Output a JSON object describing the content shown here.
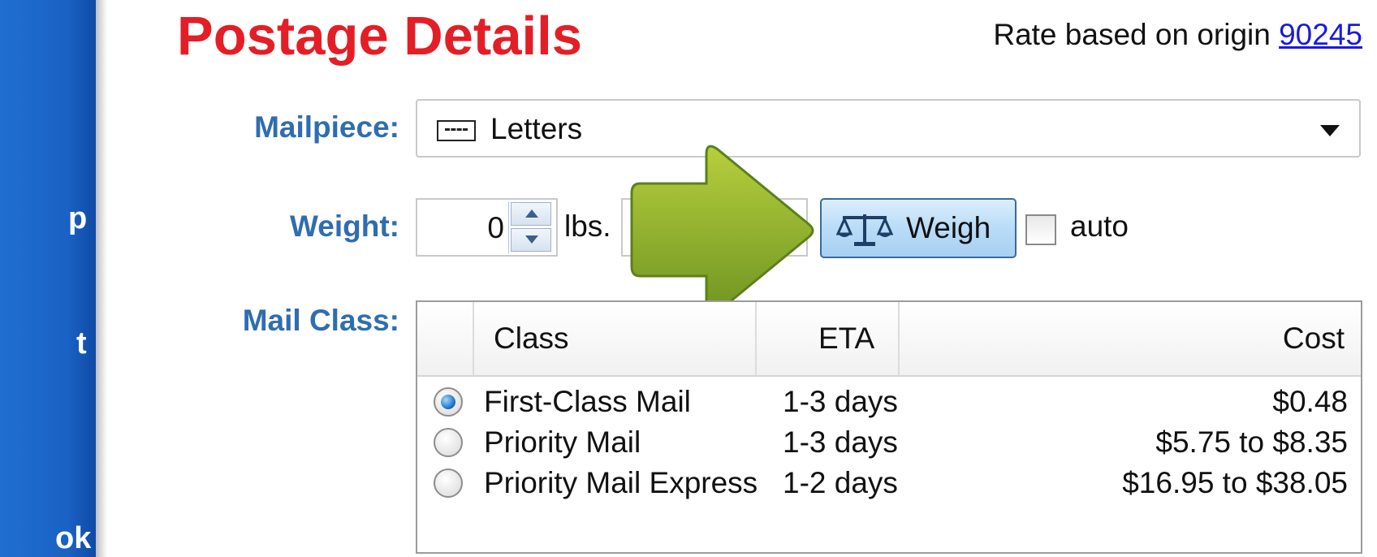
{
  "sidebar": {
    "fragments": [
      "p",
      "t",
      "ok"
    ]
  },
  "header": {
    "title": "Postage Details",
    "rate_text": "Rate based on origin ",
    "origin_zip": "90245"
  },
  "form": {
    "mailpiece_label": "Mailpiece:",
    "mailpiece_value": "Letters",
    "weight_label": "Weight:",
    "weight_lbs": "0",
    "weight_unit": "lbs.",
    "weigh_button": "Weigh",
    "auto_label": "auto",
    "mail_class_label": "Mail Class:"
  },
  "mail_class_table": {
    "headers": {
      "class": "Class",
      "eta": "ETA",
      "cost": "Cost"
    },
    "rows": [
      {
        "class": "First-Class Mail",
        "eta": "1-3 days",
        "cost": "$0.48",
        "selected": true
      },
      {
        "class": "Priority Mail",
        "eta": "1-3 days",
        "cost": "$5.75 to $8.35",
        "selected": false
      },
      {
        "class": "Priority Mail Express",
        "eta": "1-2 days",
        "cost": "$16.95 to $38.05",
        "selected": false
      }
    ]
  },
  "colors": {
    "title_red": "#e41e26",
    "label_blue": "#2f6db0",
    "sidebar_blue": "#1f6fd0",
    "arrow_green": "#7fa52a"
  },
  "icons": [
    "envelope-icon",
    "dropdown-arrow-icon",
    "scale-icon",
    "green-arrow-icon"
  ]
}
